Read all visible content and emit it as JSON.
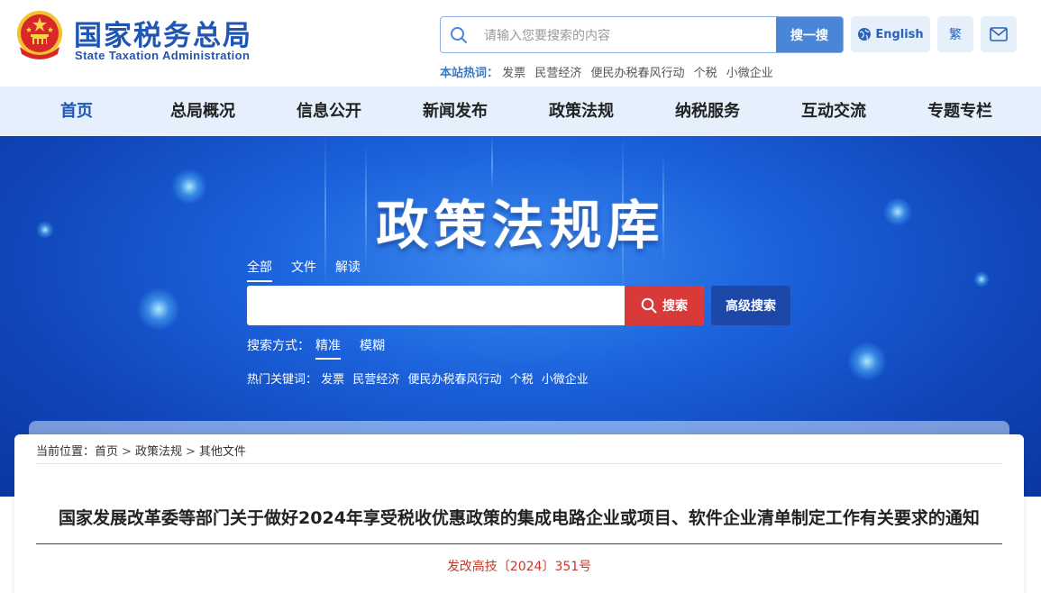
{
  "header": {
    "logo_cn": "国家税务总局",
    "logo_en": "State Taxation Administration",
    "search_placeholder": "请输入您要搜索的内容",
    "search_button": "搜一搜",
    "english_label": "English",
    "traditional_label": "繁",
    "hot_label": "本站热词：",
    "hot_words": [
      "发票",
      "民营经济",
      "便民办税春风行动",
      "个税",
      "小微企业"
    ]
  },
  "nav": {
    "items": [
      "首页",
      "总局概况",
      "信息公开",
      "新闻发布",
      "政策法规",
      "纳税服务",
      "互动交流",
      "专题专栏"
    ],
    "active_index": 0
  },
  "banner": {
    "title": "政策法规库",
    "tabs": [
      "全部",
      "文件",
      "解读"
    ],
    "active_tab": 0,
    "search_button": "搜索",
    "advanced_button": "高级搜索",
    "mode_label": "搜索方式：",
    "modes": [
      "精准",
      "模糊"
    ],
    "active_mode": 0,
    "hot_label": "热门关键词：",
    "hot_words": [
      "发票",
      "民营经济",
      "便民办税春风行动",
      "个税",
      "小微企业"
    ]
  },
  "breadcrumb": {
    "label": "当前位置：",
    "items": [
      "首页",
      "政策法规",
      "其他文件"
    ],
    "separator": ">"
  },
  "document": {
    "title": "国家发展改革委等部门关于做好2024年享受税收优惠政策的集成电路企业或项目、软件企业清单制定工作有关要求的通知",
    "number": "发改高技〔2024〕351号"
  },
  "colors": {
    "brand_blue": "#1f56b4",
    "nav_bg": "#e5f0fc",
    "search_red": "#d83a3a",
    "doc_number_red": "#c23a2c"
  }
}
